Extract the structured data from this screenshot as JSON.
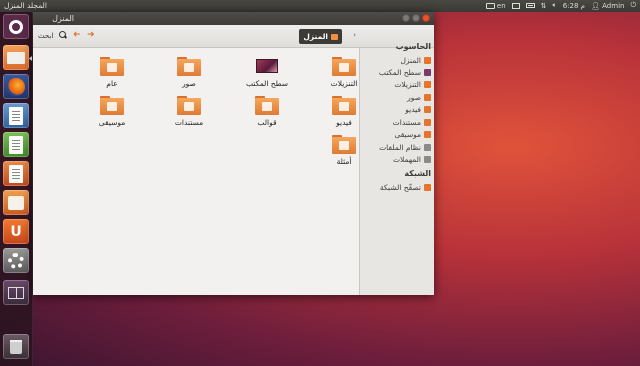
{
  "top_panel": {
    "window_title": "المجلد المنزل",
    "indicators": {
      "keyboard": "en",
      "clock": "6:28 م",
      "user": "Admin"
    }
  },
  "window": {
    "title": "المنزل",
    "location_button": "المنزل",
    "search_label": "ابحث"
  },
  "sidebar": {
    "computer_header": "الحاسوب",
    "computer_items": [
      {
        "label": "المنزل",
        "color": "#e8732c"
      },
      {
        "label": "سطح المكتب",
        "color": "#7a3a6a"
      },
      {
        "label": "التنزيلات",
        "color": "#e8732c"
      },
      {
        "label": "صور",
        "color": "#e8732c"
      },
      {
        "label": "فيديو",
        "color": "#e8732c"
      },
      {
        "label": "مستندات",
        "color": "#e8732c"
      },
      {
        "label": "موسيقى",
        "color": "#e8732c"
      },
      {
        "label": "نظام الملفات",
        "color": "#8a8a8a"
      },
      {
        "label": "المهملات",
        "color": "#8a8a8a"
      }
    ],
    "network_header": "الشبكة",
    "network_items": [
      {
        "label": "تصفّح الشبكة",
        "color": "#e8732c"
      }
    ]
  },
  "files": [
    {
      "label": "التنزيلات",
      "kind": "folder"
    },
    {
      "label": "سطح المكتب",
      "kind": "desktop"
    },
    {
      "label": "صور",
      "kind": "folder"
    },
    {
      "label": "عام",
      "kind": "folder"
    },
    {
      "label": "فيديو",
      "kind": "folder"
    },
    {
      "label": "قوالب",
      "kind": "folder"
    },
    {
      "label": "مستندات",
      "kind": "folder"
    },
    {
      "label": "موسيقى",
      "kind": "folder"
    },
    {
      "label": "أمثلة",
      "kind": "folder"
    }
  ],
  "launcher": [
    "dash-home-icon",
    "files-icon",
    "firefox-icon",
    "writer-icon",
    "calc-icon",
    "impress-icon",
    "software-center-icon",
    "ubuntu-one-icon",
    "settings-icon",
    "workspace-switcher-icon",
    "trash-icon"
  ]
}
